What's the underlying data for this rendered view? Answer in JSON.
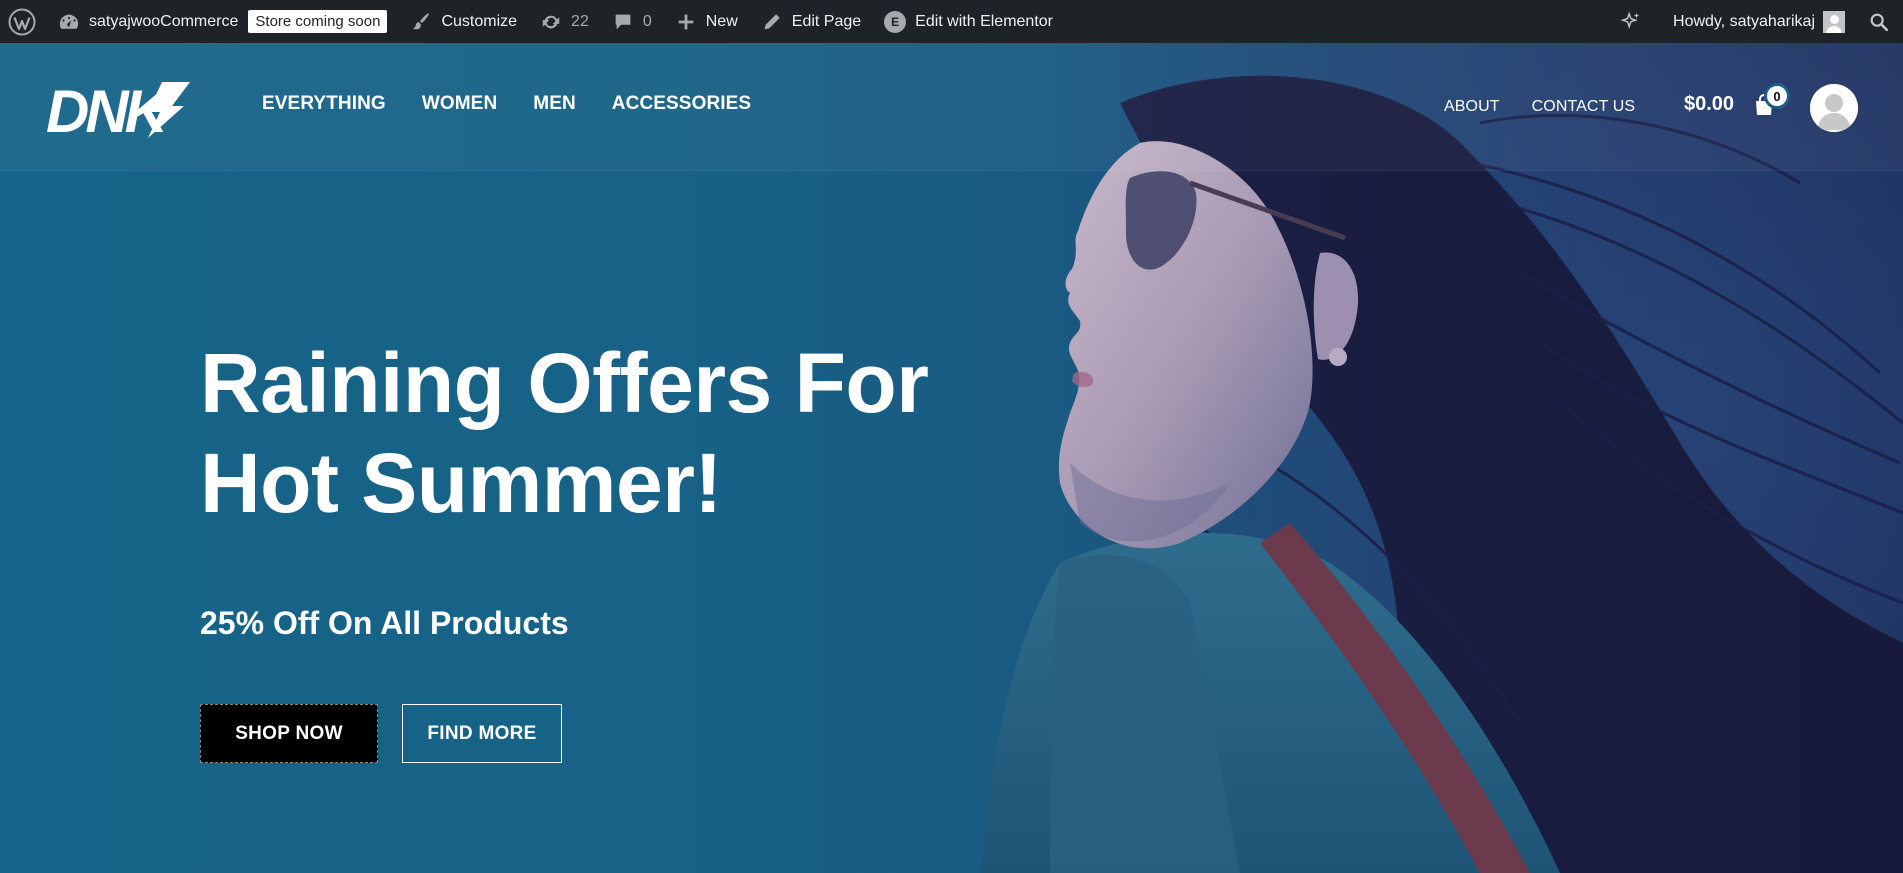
{
  "adminbar": {
    "site_name": "satyajwooCommerce",
    "store_badge": "Store coming soon",
    "customize": "Customize",
    "updates_count": "22",
    "comments_count": "0",
    "new": "New",
    "edit_page": "Edit Page",
    "edit_elementor": "Edit with Elementor",
    "elementor_glyph": "E",
    "howdy": "Howdy, satyaharikaj"
  },
  "header": {
    "logo_text": "DNK",
    "nav": [
      "EVERYTHING",
      "WOMEN",
      "MEN",
      "ACCESSORIES"
    ],
    "secondary_nav": [
      "ABOUT",
      "CONTACT US"
    ],
    "cart_total": "$0.00",
    "cart_count": "0"
  },
  "hero": {
    "title_line1": "Raining Offers For",
    "title_line2": "Hot Summer!",
    "subtitle": "25% Off On All Products",
    "primary_button": "SHOP NOW",
    "secondary_button": "FIND MORE"
  },
  "colors": {
    "adminbar_bg": "#1d2327",
    "hero_blue": "#17648a",
    "button_dark": "#000000"
  }
}
